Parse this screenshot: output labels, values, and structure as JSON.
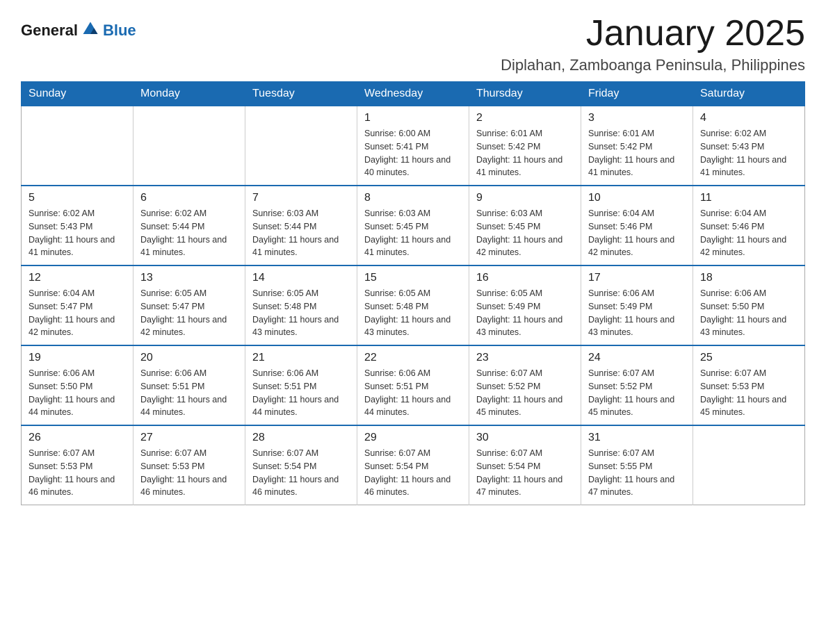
{
  "header": {
    "logo": {
      "general": "General",
      "blue": "Blue"
    },
    "title": "January 2025",
    "subtitle": "Diplahan, Zamboanga Peninsula, Philippines"
  },
  "calendar": {
    "days_of_week": [
      "Sunday",
      "Monday",
      "Tuesday",
      "Wednesday",
      "Thursday",
      "Friday",
      "Saturday"
    ],
    "weeks": [
      [
        {
          "day": "",
          "info": ""
        },
        {
          "day": "",
          "info": ""
        },
        {
          "day": "",
          "info": ""
        },
        {
          "day": "1",
          "info": "Sunrise: 6:00 AM\nSunset: 5:41 PM\nDaylight: 11 hours and 40 minutes."
        },
        {
          "day": "2",
          "info": "Sunrise: 6:01 AM\nSunset: 5:42 PM\nDaylight: 11 hours and 41 minutes."
        },
        {
          "day": "3",
          "info": "Sunrise: 6:01 AM\nSunset: 5:42 PM\nDaylight: 11 hours and 41 minutes."
        },
        {
          "day": "4",
          "info": "Sunrise: 6:02 AM\nSunset: 5:43 PM\nDaylight: 11 hours and 41 minutes."
        }
      ],
      [
        {
          "day": "5",
          "info": "Sunrise: 6:02 AM\nSunset: 5:43 PM\nDaylight: 11 hours and 41 minutes."
        },
        {
          "day": "6",
          "info": "Sunrise: 6:02 AM\nSunset: 5:44 PM\nDaylight: 11 hours and 41 minutes."
        },
        {
          "day": "7",
          "info": "Sunrise: 6:03 AM\nSunset: 5:44 PM\nDaylight: 11 hours and 41 minutes."
        },
        {
          "day": "8",
          "info": "Sunrise: 6:03 AM\nSunset: 5:45 PM\nDaylight: 11 hours and 41 minutes."
        },
        {
          "day": "9",
          "info": "Sunrise: 6:03 AM\nSunset: 5:45 PM\nDaylight: 11 hours and 42 minutes."
        },
        {
          "day": "10",
          "info": "Sunrise: 6:04 AM\nSunset: 5:46 PM\nDaylight: 11 hours and 42 minutes."
        },
        {
          "day": "11",
          "info": "Sunrise: 6:04 AM\nSunset: 5:46 PM\nDaylight: 11 hours and 42 minutes."
        }
      ],
      [
        {
          "day": "12",
          "info": "Sunrise: 6:04 AM\nSunset: 5:47 PM\nDaylight: 11 hours and 42 minutes."
        },
        {
          "day": "13",
          "info": "Sunrise: 6:05 AM\nSunset: 5:47 PM\nDaylight: 11 hours and 42 minutes."
        },
        {
          "day": "14",
          "info": "Sunrise: 6:05 AM\nSunset: 5:48 PM\nDaylight: 11 hours and 43 minutes."
        },
        {
          "day": "15",
          "info": "Sunrise: 6:05 AM\nSunset: 5:48 PM\nDaylight: 11 hours and 43 minutes."
        },
        {
          "day": "16",
          "info": "Sunrise: 6:05 AM\nSunset: 5:49 PM\nDaylight: 11 hours and 43 minutes."
        },
        {
          "day": "17",
          "info": "Sunrise: 6:06 AM\nSunset: 5:49 PM\nDaylight: 11 hours and 43 minutes."
        },
        {
          "day": "18",
          "info": "Sunrise: 6:06 AM\nSunset: 5:50 PM\nDaylight: 11 hours and 43 minutes."
        }
      ],
      [
        {
          "day": "19",
          "info": "Sunrise: 6:06 AM\nSunset: 5:50 PM\nDaylight: 11 hours and 44 minutes."
        },
        {
          "day": "20",
          "info": "Sunrise: 6:06 AM\nSunset: 5:51 PM\nDaylight: 11 hours and 44 minutes."
        },
        {
          "day": "21",
          "info": "Sunrise: 6:06 AM\nSunset: 5:51 PM\nDaylight: 11 hours and 44 minutes."
        },
        {
          "day": "22",
          "info": "Sunrise: 6:06 AM\nSunset: 5:51 PM\nDaylight: 11 hours and 44 minutes."
        },
        {
          "day": "23",
          "info": "Sunrise: 6:07 AM\nSunset: 5:52 PM\nDaylight: 11 hours and 45 minutes."
        },
        {
          "day": "24",
          "info": "Sunrise: 6:07 AM\nSunset: 5:52 PM\nDaylight: 11 hours and 45 minutes."
        },
        {
          "day": "25",
          "info": "Sunrise: 6:07 AM\nSunset: 5:53 PM\nDaylight: 11 hours and 45 minutes."
        }
      ],
      [
        {
          "day": "26",
          "info": "Sunrise: 6:07 AM\nSunset: 5:53 PM\nDaylight: 11 hours and 46 minutes."
        },
        {
          "day": "27",
          "info": "Sunrise: 6:07 AM\nSunset: 5:53 PM\nDaylight: 11 hours and 46 minutes."
        },
        {
          "day": "28",
          "info": "Sunrise: 6:07 AM\nSunset: 5:54 PM\nDaylight: 11 hours and 46 minutes."
        },
        {
          "day": "29",
          "info": "Sunrise: 6:07 AM\nSunset: 5:54 PM\nDaylight: 11 hours and 46 minutes."
        },
        {
          "day": "30",
          "info": "Sunrise: 6:07 AM\nSunset: 5:54 PM\nDaylight: 11 hours and 47 minutes."
        },
        {
          "day": "31",
          "info": "Sunrise: 6:07 AM\nSunset: 5:55 PM\nDaylight: 11 hours and 47 minutes."
        },
        {
          "day": "",
          "info": ""
        }
      ]
    ]
  }
}
